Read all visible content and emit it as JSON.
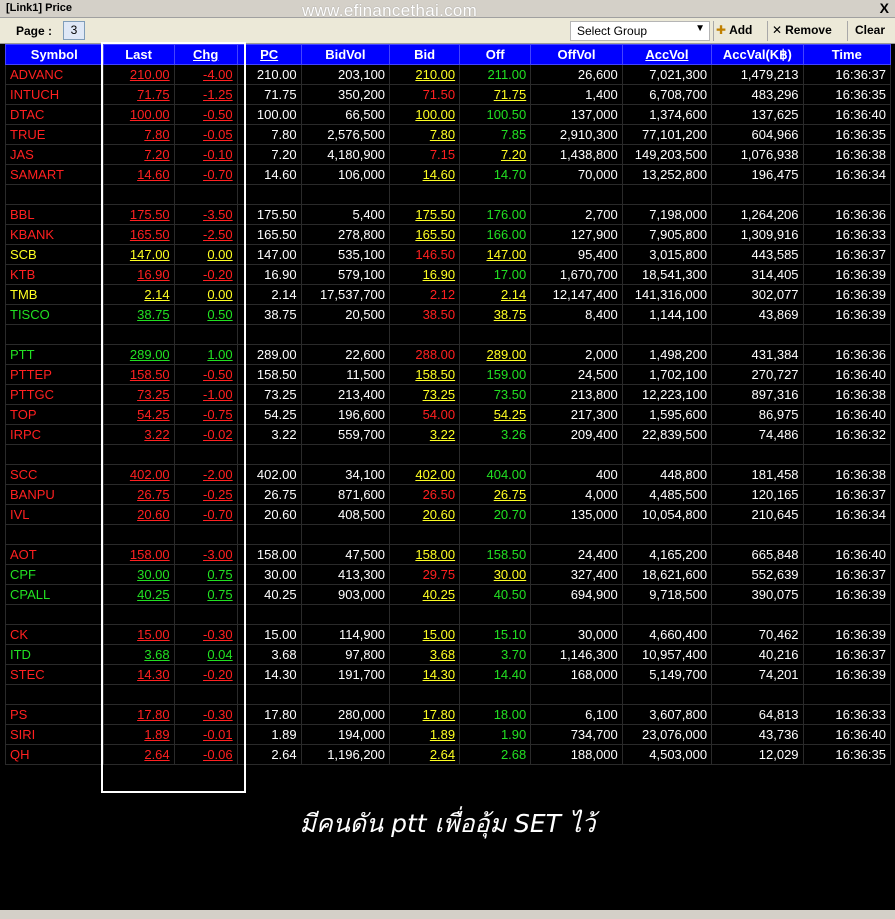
{
  "window": {
    "title": "[Link1] Price",
    "watermark": "www.efinancethai.com",
    "close_glyph": "X"
  },
  "toolbar": {
    "page_label": "Page :",
    "page_value": "3",
    "group_select_value": "Select Group",
    "add_label": "Add",
    "remove_label": "Remove",
    "clear_label": "Clear"
  },
  "columns": [
    "Symbol",
    "Last",
    "Chg",
    "PC",
    "BidVol",
    "Bid",
    "Off",
    "OffVol",
    "AccVol",
    "AccVal(K฿)",
    "Time"
  ],
  "rows": [
    {
      "symbol": "ADVANC",
      "last": "210.00",
      "chg": "-4.00",
      "pc": "210.00",
      "bidvol": "203,100",
      "bid": "210.00",
      "off": "211.00",
      "offvol": "26,600",
      "accvol": "7,021,300",
      "accval": "1,479,213",
      "time": "16:36:37"
    },
    {
      "symbol": "INTUCH",
      "last": "71.75",
      "chg": "-1.25",
      "pc": "71.75",
      "bidvol": "350,200",
      "bid": "71.50",
      "off": "71.75",
      "offvol": "1,400",
      "accvol": "6,708,700",
      "accval": "483,296",
      "time": "16:36:35"
    },
    {
      "symbol": "DTAC",
      "last": "100.00",
      "chg": "-0.50",
      "pc": "100.00",
      "bidvol": "66,500",
      "bid": "100.00",
      "off": "100.50",
      "offvol": "137,000",
      "accvol": "1,374,600",
      "accval": "137,625",
      "time": "16:36:40"
    },
    {
      "symbol": "TRUE",
      "last": "7.80",
      "chg": "-0.05",
      "pc": "7.80",
      "bidvol": "2,576,500",
      "bid": "7.80",
      "off": "7.85",
      "offvol": "2,910,300",
      "accvol": "77,101,200",
      "accval": "604,966",
      "time": "16:36:35"
    },
    {
      "symbol": "JAS",
      "last": "7.20",
      "chg": "-0.10",
      "pc": "7.20",
      "bidvol": "4,180,900",
      "bid": "7.15",
      "off": "7.20",
      "offvol": "1,438,800",
      "accvol": "149,203,500",
      "accval": "1,076,938",
      "time": "16:36:38"
    },
    {
      "symbol": "SAMART",
      "last": "14.60",
      "chg": "-0.70",
      "pc": "14.60",
      "bidvol": "106,000",
      "bid": "14.60",
      "off": "14.70",
      "offvol": "70,000",
      "accvol": "13,252,800",
      "accval": "196,475",
      "time": "16:36:34"
    },
    {
      "blank": true
    },
    {
      "symbol": "BBL",
      "last": "175.50",
      "chg": "-3.50",
      "pc": "175.50",
      "bidvol": "5,400",
      "bid": "175.50",
      "off": "176.00",
      "offvol": "2,700",
      "accvol": "7,198,000",
      "accval": "1,264,206",
      "time": "16:36:36"
    },
    {
      "symbol": "KBANK",
      "last": "165.50",
      "chg": "-2.50",
      "pc": "165.50",
      "bidvol": "278,800",
      "bid": "165.50",
      "off": "166.00",
      "offvol": "127,900",
      "accvol": "7,905,800",
      "accval": "1,309,916",
      "time": "16:36:33"
    },
    {
      "symbol": "SCB",
      "last": "147.00",
      "chg": "0.00",
      "pc": "147.00",
      "bidvol": "535,100",
      "bid": "146.50",
      "off": "147.00",
      "offvol": "95,400",
      "accvol": "3,015,800",
      "accval": "443,585",
      "time": "16:36:37"
    },
    {
      "symbol": "KTB",
      "last": "16.90",
      "chg": "-0.20",
      "pc": "16.90",
      "bidvol": "579,100",
      "bid": "16.90",
      "off": "17.00",
      "offvol": "1,670,700",
      "accvol": "18,541,300",
      "accval": "314,405",
      "time": "16:36:39"
    },
    {
      "symbol": "TMB",
      "last": "2.14",
      "chg": "0.00",
      "pc": "2.14",
      "bidvol": "17,537,700",
      "bid": "2.12",
      "off": "2.14",
      "offvol": "12,147,400",
      "accvol": "141,316,000",
      "accval": "302,077",
      "time": "16:36:39"
    },
    {
      "symbol": "TISCO",
      "last": "38.75",
      "chg": "0.50",
      "pc": "38.75",
      "bidvol": "20,500",
      "bid": "38.50",
      "off": "38.75",
      "offvol": "8,400",
      "accvol": "1,144,100",
      "accval": "43,869",
      "time": "16:36:39"
    },
    {
      "blank": true
    },
    {
      "symbol": "PTT",
      "last": "289.00",
      "chg": "1.00",
      "pc": "289.00",
      "bidvol": "22,600",
      "bid": "288.00",
      "off": "289.00",
      "offvol": "2,000",
      "accvol": "1,498,200",
      "accval": "431,384",
      "time": "16:36:36"
    },
    {
      "symbol": "PTTEP",
      "last": "158.50",
      "chg": "-0.50",
      "pc": "158.50",
      "bidvol": "11,500",
      "bid": "158.50",
      "off": "159.00",
      "offvol": "24,500",
      "accvol": "1,702,100",
      "accval": "270,727",
      "time": "16:36:40"
    },
    {
      "symbol": "PTTGC",
      "last": "73.25",
      "chg": "-1.00",
      "pc": "73.25",
      "bidvol": "213,400",
      "bid": "73.25",
      "off": "73.50",
      "offvol": "213,800",
      "accvol": "12,223,100",
      "accval": "897,316",
      "time": "16:36:38"
    },
    {
      "symbol": "TOP",
      "last": "54.25",
      "chg": "-0.75",
      "pc": "54.25",
      "bidvol": "196,600",
      "bid": "54.00",
      "off": "54.25",
      "offvol": "217,300",
      "accvol": "1,595,600",
      "accval": "86,975",
      "time": "16:36:40"
    },
    {
      "symbol": "IRPC",
      "last": "3.22",
      "chg": "-0.02",
      "pc": "3.22",
      "bidvol": "559,700",
      "bid": "3.22",
      "off": "3.26",
      "offvol": "209,400",
      "accvol": "22,839,500",
      "accval": "74,486",
      "time": "16:36:32"
    },
    {
      "blank": true
    },
    {
      "symbol": "SCC",
      "last": "402.00",
      "chg": "-2.00",
      "pc": "402.00",
      "bidvol": "34,100",
      "bid": "402.00",
      "off": "404.00",
      "offvol": "400",
      "accvol": "448,800",
      "accval": "181,458",
      "time": "16:36:38"
    },
    {
      "symbol": "BANPU",
      "last": "26.75",
      "chg": "-0.25",
      "pc": "26.75",
      "bidvol": "871,600",
      "bid": "26.50",
      "off": "26.75",
      "offvol": "4,000",
      "accvol": "4,485,500",
      "accval": "120,165",
      "time": "16:36:37"
    },
    {
      "symbol": "IVL",
      "last": "20.60",
      "chg": "-0.70",
      "pc": "20.60",
      "bidvol": "408,500",
      "bid": "20.60",
      "off": "20.70",
      "offvol": "135,000",
      "accvol": "10,054,800",
      "accval": "210,645",
      "time": "16:36:34"
    },
    {
      "blank": true
    },
    {
      "symbol": "AOT",
      "last": "158.00",
      "chg": "-3.00",
      "pc": "158.00",
      "bidvol": "47,500",
      "bid": "158.00",
      "off": "158.50",
      "offvol": "24,400",
      "accvol": "4,165,200",
      "accval": "665,848",
      "time": "16:36:40"
    },
    {
      "symbol": "CPF",
      "last": "30.00",
      "chg": "0.75",
      "pc": "30.00",
      "bidvol": "413,300",
      "bid": "29.75",
      "off": "30.00",
      "offvol": "327,400",
      "accvol": "18,621,600",
      "accval": "552,639",
      "time": "16:36:37"
    },
    {
      "symbol": "CPALL",
      "last": "40.25",
      "chg": "0.75",
      "pc": "40.25",
      "bidvol": "903,000",
      "bid": "40.25",
      "off": "40.50",
      "offvol": "694,900",
      "accvol": "9,718,500",
      "accval": "390,075",
      "time": "16:36:39"
    },
    {
      "blank": true
    },
    {
      "symbol": "CK",
      "last": "15.00",
      "chg": "-0.30",
      "pc": "15.00",
      "bidvol": "114,900",
      "bid": "15.00",
      "off": "15.10",
      "offvol": "30,000",
      "accvol": "4,660,400",
      "accval": "70,462",
      "time": "16:36:39"
    },
    {
      "symbol": "ITD",
      "last": "3.68",
      "chg": "0.04",
      "pc": "3.68",
      "bidvol": "97,800",
      "bid": "3.68",
      "off": "3.70",
      "offvol": "1,146,300",
      "accvol": "10,957,400",
      "accval": "40,216",
      "time": "16:36:37"
    },
    {
      "symbol": "STEC",
      "last": "14.30",
      "chg": "-0.20",
      "pc": "14.30",
      "bidvol": "191,700",
      "bid": "14.30",
      "off": "14.40",
      "offvol": "168,000",
      "accvol": "5,149,700",
      "accval": "74,201",
      "time": "16:36:39"
    },
    {
      "blank": true
    },
    {
      "symbol": "PS",
      "last": "17.80",
      "chg": "-0.30",
      "pc": "17.80",
      "bidvol": "280,000",
      "bid": "17.80",
      "off": "18.00",
      "offvol": "6,100",
      "accvol": "3,607,800",
      "accval": "64,813",
      "time": "16:36:33"
    },
    {
      "symbol": "SIRI",
      "last": "1.89",
      "chg": "-0.01",
      "pc": "1.89",
      "bidvol": "194,000",
      "bid": "1.89",
      "off": "1.90",
      "offvol": "734,700",
      "accvol": "23,076,000",
      "accval": "43,736",
      "time": "16:36:40"
    },
    {
      "symbol": "QH",
      "last": "2.64",
      "chg": "-0.06",
      "pc": "2.64",
      "bidvol": "1,196,200",
      "bid": "2.64",
      "off": "2.68",
      "offvol": "188,000",
      "accvol": "4,503,000",
      "accval": "12,029",
      "time": "16:36:35"
    }
  ],
  "caption": "มีคนดัน ptt เพื่ออุ้ม SET ไว้",
  "colors": {
    "header_bg": "#0000ff",
    "down": "#ff2020",
    "up": "#22e022",
    "unchanged": "#ffff22",
    "neutral": "#ffffff"
  }
}
